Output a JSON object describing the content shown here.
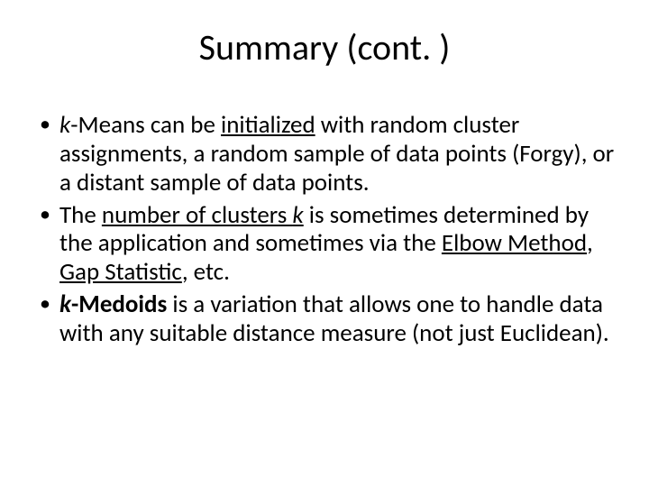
{
  "title": "Summary (cont. )",
  "bullets": [
    {
      "t1_ital": "k",
      "t2": "-Means can be ",
      "t3_u": "initialized",
      "t4": " with random cluster assignments, a random sample of data points (Forgy), or a distant sample of data points."
    },
    {
      "t1": "The ",
      "t2_u": "number of clusters ",
      "t2b_u_ital": "k",
      "t3": " is sometimes determined by the application and sometimes via the ",
      "t4_u": "Elbow Method",
      "t5": ", ",
      "t6_u": "Gap Statistic",
      "t7": ", etc."
    },
    {
      "t1_b_ital": "k",
      "t1b_b": "-Medoids",
      "t2": " is a variation that allows one to handle data with any suitable distance measure (not just Euclidean)."
    }
  ]
}
